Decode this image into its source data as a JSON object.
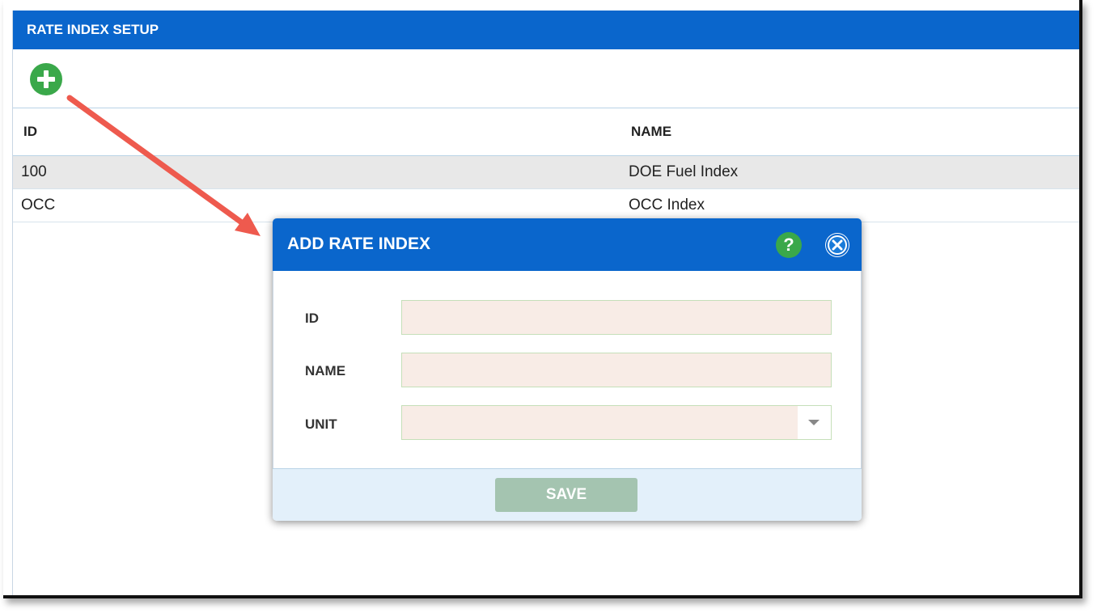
{
  "panel": {
    "title": "RATE INDEX SETUP",
    "add_icon": "plus-circle-icon"
  },
  "table": {
    "columns": [
      "ID",
      "NAME"
    ],
    "rows": [
      {
        "id": "100",
        "name": "DOE Fuel Index"
      },
      {
        "id": "OCC",
        "name": "OCC Index"
      }
    ]
  },
  "annotation": {
    "arrow_color": "#ee5a4e"
  },
  "modal": {
    "title": "ADD RATE INDEX",
    "help_label": "?",
    "close_icon": "close-x-circle-icon",
    "fields": {
      "id_label": "ID",
      "id_value": "",
      "name_label": "NAME",
      "name_value": "",
      "unit_label": "UNIT",
      "unit_value": ""
    },
    "save_label": "SAVE"
  },
  "colors": {
    "header_blue": "#0a66cc",
    "add_green": "#3aa84a",
    "input_bg": "#f8ece6",
    "save_disabled": "#a4c4b0"
  }
}
